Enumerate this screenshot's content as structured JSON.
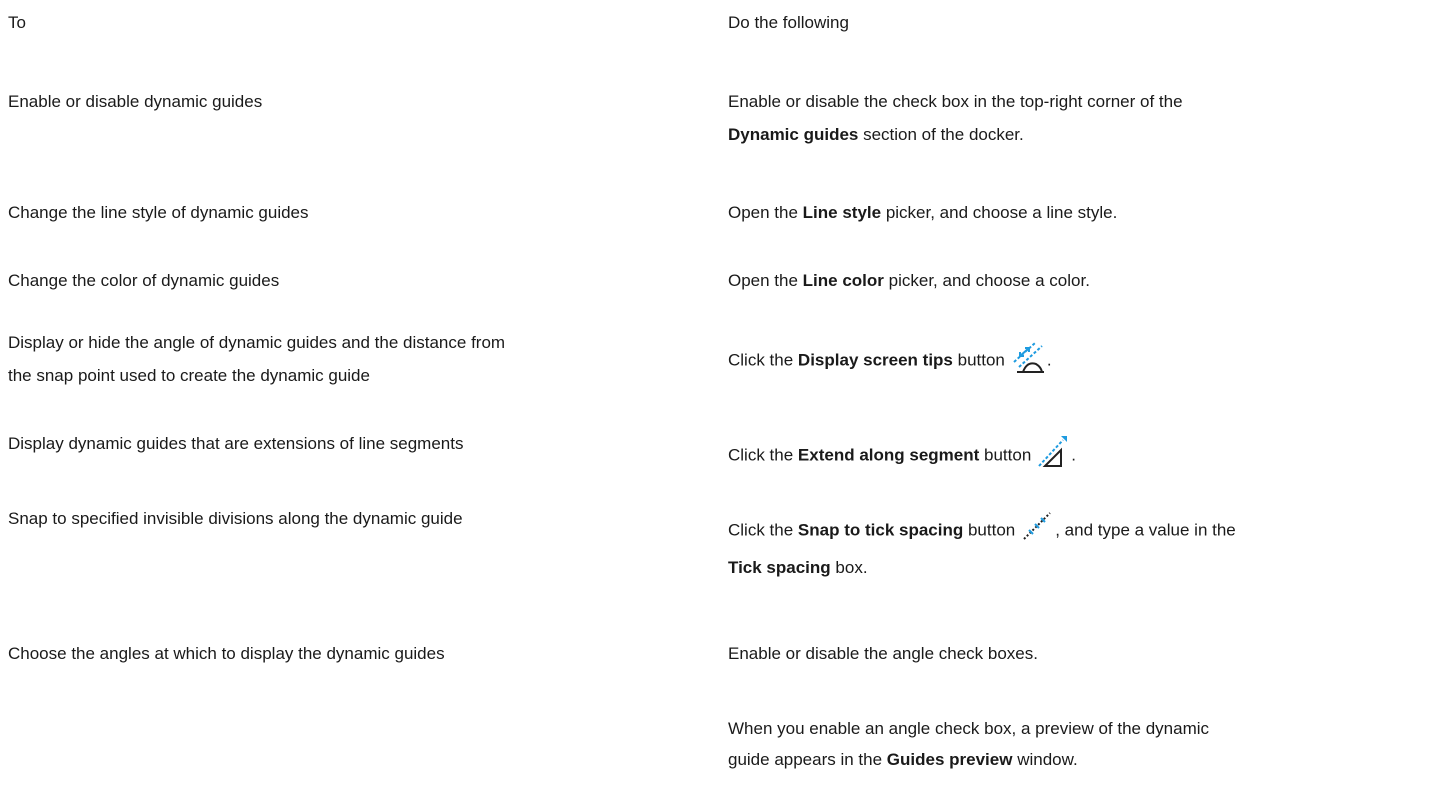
{
  "header": {
    "col1": "To",
    "col2": "Do the following"
  },
  "rows": [
    {
      "task": "Enable or disable dynamic guides",
      "instr": {
        "a": "Enable or disable the check box in the top-right corner of the",
        "b": "Dynamic guides",
        "c": " section of the docker."
      }
    },
    {
      "task": "Change the line style of dynamic guides",
      "instr": {
        "a": "Open the ",
        "b": "Line style",
        "c": " picker, and choose a line style."
      }
    },
    {
      "task": "Change the color of dynamic guides",
      "instr": {
        "a": "Open the ",
        "b": "Line color",
        "c": " picker, and choose a color."
      }
    },
    {
      "task_line1": "Display or hide the angle of dynamic guides and the distance from",
      "task_line2": "the snap point used to create the dynamic guide",
      "instr": {
        "a": "Click the ",
        "b": "Display screen tips",
        "c": " button",
        "d": "."
      },
      "icon": "display-screen-tips-icon"
    },
    {
      "task": "Display dynamic guides that are extensions of line segments",
      "instr": {
        "a": "Click the ",
        "b": "Extend along segment",
        "c": " button",
        "d": "."
      },
      "icon": "extend-along-segment-icon"
    },
    {
      "task": "Snap to specified invisible divisions along the dynamic guide",
      "instr": {
        "a": "Click the ",
        "b": "Snap to tick spacing",
        "c": " button",
        "d": ", and type a value in the",
        "e": "Tick spacing",
        "f": " box."
      },
      "icon": "snap-to-tick-spacing-icon"
    },
    {
      "task": "Choose the angles at which to display the dynamic guides",
      "instr": {
        "a": "Enable or disable the angle check boxes."
      },
      "instr2": {
        "a": "When you enable an angle check box, a preview of the dynamic",
        "b": "guide appears in the ",
        "c": "Guides preview",
        "d": " window."
      }
    }
  ],
  "colors": {
    "text": "#1a1a1a",
    "icon_blue": "#1e9be0",
    "icon_dark": "#222222"
  }
}
